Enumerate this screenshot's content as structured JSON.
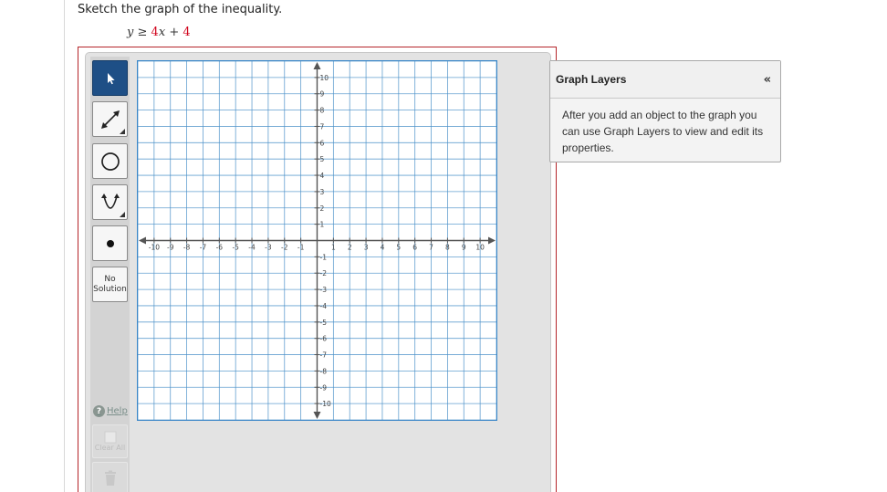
{
  "question": {
    "instruction": "Sketch the graph of the inequality.",
    "inequality": {
      "lhs": "y",
      "op": "≥",
      "coef": "4",
      "var": "x",
      "plus": "+",
      "const": "4"
    }
  },
  "toolbar": {
    "tools": [
      {
        "id": "select",
        "icon": "arrow-pointer-icon"
      },
      {
        "id": "line",
        "icon": "line-segment-icon"
      },
      {
        "id": "circle",
        "icon": "circle-icon"
      },
      {
        "id": "parabola",
        "icon": "parabola-icon"
      },
      {
        "id": "point",
        "icon": "point-icon"
      }
    ],
    "no_solution_line1": "No",
    "no_solution_line2": "Solution",
    "help_label": "Help",
    "clear_all_label": "Clear All"
  },
  "graph": {
    "x_ticks": [
      -10,
      -9,
      -8,
      -7,
      -6,
      -5,
      -4,
      -3,
      -2,
      -1,
      1,
      2,
      3,
      4,
      5,
      6,
      7,
      8,
      9,
      10
    ],
    "y_ticks": [
      -10,
      -9,
      -8,
      -7,
      -6,
      -5,
      -4,
      -3,
      -2,
      -1,
      1,
      2,
      3,
      4,
      5,
      6,
      7,
      8,
      9,
      10
    ],
    "xlim": [
      -11,
      11
    ],
    "ylim": [
      -11,
      11
    ],
    "grid_color": "#4a90c8",
    "axis_color": "#555555"
  },
  "layers": {
    "title": "Graph Layers",
    "collapse_glyph": "«",
    "body": "After you add an object to the graph you can use Graph Layers to view and edit its properties."
  }
}
